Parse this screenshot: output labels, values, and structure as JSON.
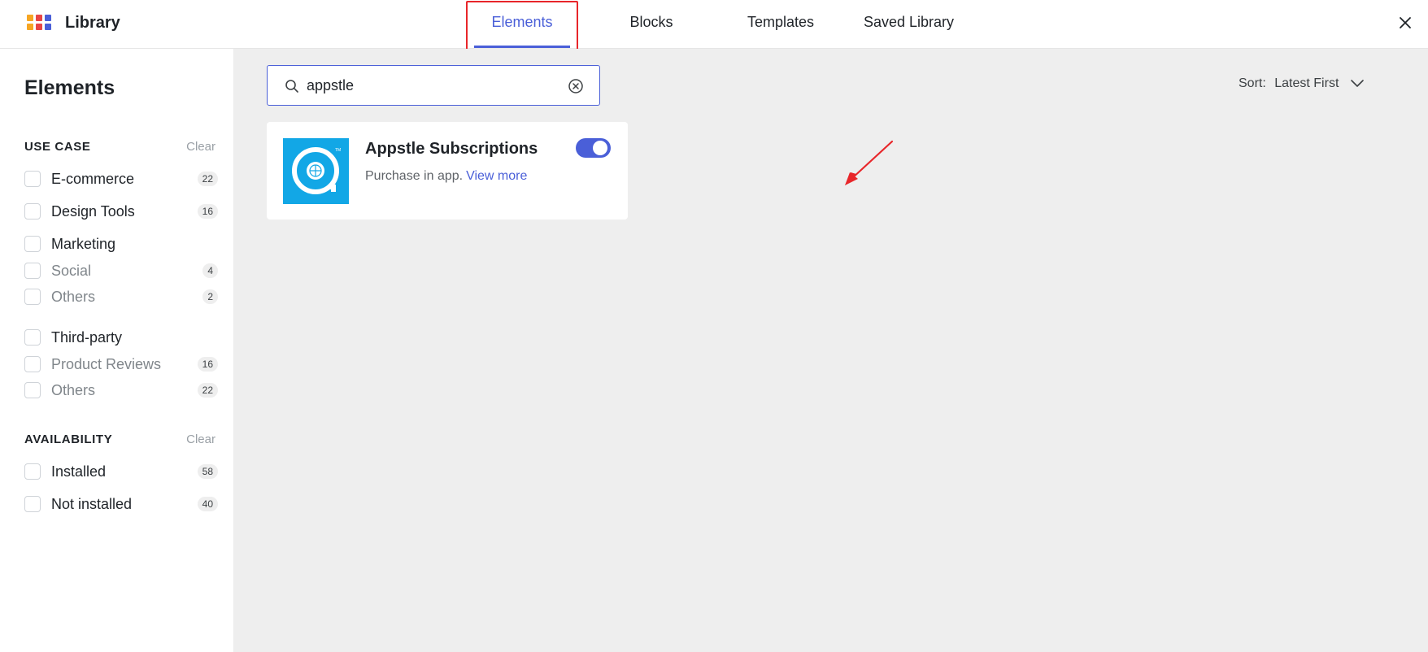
{
  "header": {
    "brand": "Library",
    "tabs": [
      {
        "label": "Elements",
        "active": true
      },
      {
        "label": "Blocks",
        "active": false
      },
      {
        "label": "Templates",
        "active": false
      },
      {
        "label": "Saved Library",
        "active": false
      }
    ],
    "close_icon": "close-icon"
  },
  "sidebar": {
    "title": "Elements",
    "use_case": {
      "title": "USE CASE",
      "clear": "Clear",
      "items": [
        {
          "label": "E-commerce",
          "count": "22"
        },
        {
          "label": "Design Tools",
          "count": "16"
        },
        {
          "label": "Marketing",
          "count": ""
        },
        {
          "label": "Social",
          "count": "4"
        },
        {
          "label": "Others",
          "count": "2"
        },
        {
          "label": "Third-party",
          "count": ""
        },
        {
          "label": "Product Reviews",
          "count": "16"
        },
        {
          "label": "Others",
          "count": "22"
        }
      ]
    },
    "availability": {
      "title": "AVAILABILITY",
      "clear": "Clear",
      "items": [
        {
          "label": "Installed",
          "count": "58"
        },
        {
          "label": "Not installed",
          "count": "40"
        }
      ]
    }
  },
  "main": {
    "search": {
      "value": "appstle",
      "placeholder": "Search"
    },
    "sort": {
      "label": "Sort:",
      "value": "Latest First"
    },
    "results": [
      {
        "title": "Appstle Subscriptions",
        "description": "Purchase in app.",
        "link": "View more",
        "enabled": true
      }
    ]
  },
  "colors": {
    "accent": "#4a5fd8",
    "highlight": "#e8262a",
    "app_icon_bg": "#12a7e6"
  }
}
